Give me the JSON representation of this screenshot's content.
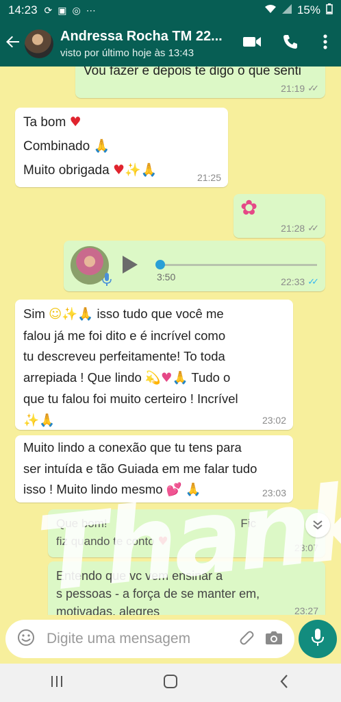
{
  "status": {
    "time": "14:23",
    "battery": "15%"
  },
  "header": {
    "title": "Andressa Rocha TM 22...",
    "subtitle": "visto por último hoje às 13:43"
  },
  "messages": [
    {
      "type": "out",
      "text": "Vou fazer e depois te digo o que senti",
      "time": "21:19",
      "ticks": "read-gray"
    },
    {
      "type": "in",
      "lines": [
        "Ta bom",
        "Combinado",
        "Muito obrigada"
      ],
      "time": "21:25"
    },
    {
      "type": "out",
      "time": "21:28",
      "ticks": "gray"
    },
    {
      "type": "out-voice",
      "duration": "3:50",
      "time": "22:33",
      "ticks": "blue"
    },
    {
      "type": "in",
      "text_1": "Sim",
      "text_2": "isso tudo que você me",
      "text_3": "falou já  me foi dito e é  incrível como",
      "text_4": "tu descreveu perfeitamente! To toda",
      "text_5": "arrepiada ! Que lindo",
      "text_6": "Tudo o",
      "text_7": "que tu falou foi muito certeiro ! Incrível",
      "time": "23:02"
    },
    {
      "type": "in",
      "text_1": "Muito lindo a conexão que tu tens para",
      "text_2": "ser intuída e tão Guiada em me falar tudo",
      "text_3": "isso ! Muito lindo mesmo",
      "time": "23:03"
    },
    {
      "type": "out",
      "text_1": "Que bom!",
      "text_2": "Fic",
      "text_3": "fiz quando",
      "text_4": "te conto",
      "time": "23:07"
    },
    {
      "type": "out",
      "text_1": "Entendo que vc vem ensinar a",
      "text_2": "s pessoas - a força de se manter em,",
      "text_3": "motivadas, alegres",
      "time": "23:27"
    }
  ],
  "overlay_text": "Thank U",
  "input": {
    "placeholder": "Digite uma mensagem"
  },
  "icons": {
    "back": "arrow-left-icon",
    "video": "video-call-icon",
    "call": "phone-icon",
    "menu": "more-vert-icon",
    "emoji": "emoji-icon",
    "attach": "paperclip-icon",
    "camera": "camera-icon",
    "mic": "microphone-icon"
  },
  "colors": {
    "header": "#075e54",
    "chat_bg": "#f7ef9c",
    "outgoing": "#dcf8c6",
    "incoming": "#ffffff",
    "mic_button": "#128c7e",
    "read_ticks": "#34b7f1"
  }
}
